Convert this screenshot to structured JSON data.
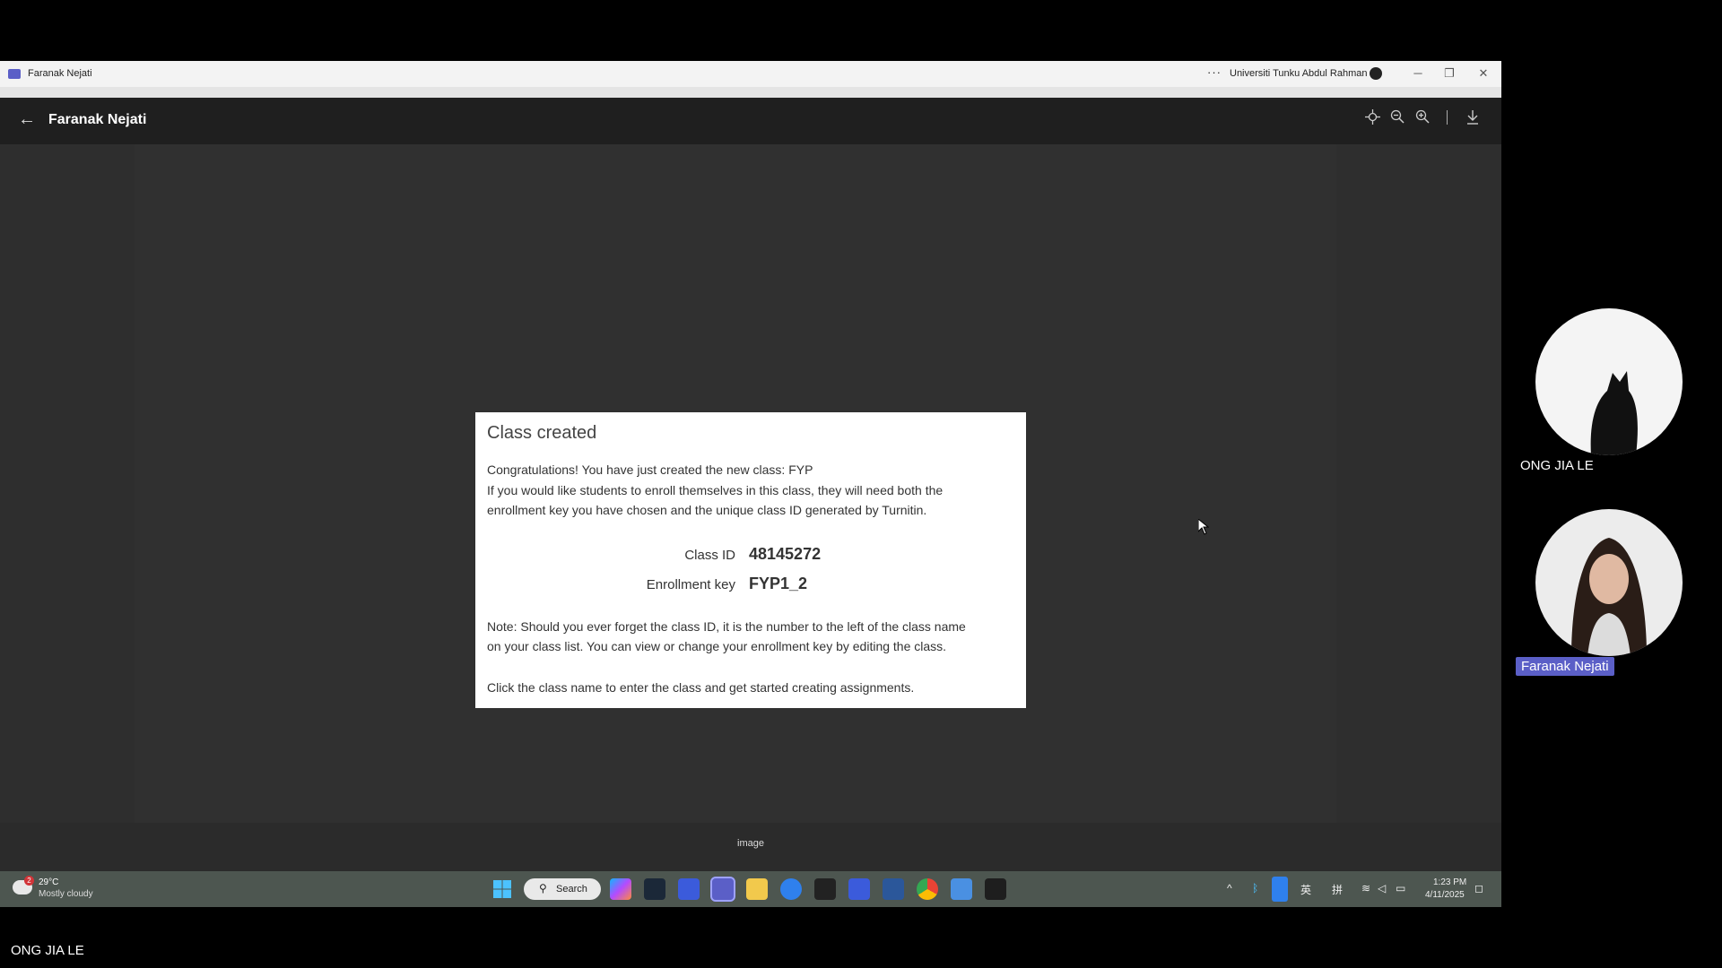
{
  "window": {
    "title": "Faranak Nejati",
    "org": "Universiti Tunku Abdul Rahman",
    "more": "···",
    "minimize": "─",
    "maximize": "❐",
    "close": "✕"
  },
  "viewer": {
    "back_icon": "←",
    "title": "Faranak Nejati",
    "icons": [
      "recenter-icon",
      "zoom-out-icon",
      "zoom-in-icon",
      "divider",
      "download-icon"
    ],
    "caption": "image"
  },
  "dialog": {
    "title": "Class created",
    "line1": "Congratulations! You have just created the new class: FYP",
    "line2": "If you would like students to enroll themselves in this class, they will need both the",
    "line3": "enrollment key you have chosen and the unique class ID generated by Turnitin.",
    "class_id_label": "Class ID",
    "class_id_value": "48145272",
    "enroll_label": "Enrollment key",
    "enroll_value": "FYP1_2",
    "note1": "Note: Should you ever forget the class ID, it is the number to the left of the class name",
    "note2": "on your class list. You can view or change your enrollment key by editing the class.",
    "cta": "Click the class name to enter the class and get started creating assignments."
  },
  "taskbar": {
    "weather_badge": "2",
    "temperature": "29°C",
    "condition": "Mostly cloudy",
    "search_label": "Search",
    "tray_ime1": "英",
    "tray_ime2": "拼",
    "time": "1:23 PM",
    "date": "4/11/2025"
  },
  "participants": [
    {
      "name": "ONG JIA LE"
    },
    {
      "name": "Faranak Nejati"
    }
  ],
  "self_view_name": "ONG JIA LE",
  "colors": {
    "teams_accent": "#5b5fc7",
    "viewer_bg": "#2e2e2e",
    "taskbar_bg": "#4d5650"
  }
}
